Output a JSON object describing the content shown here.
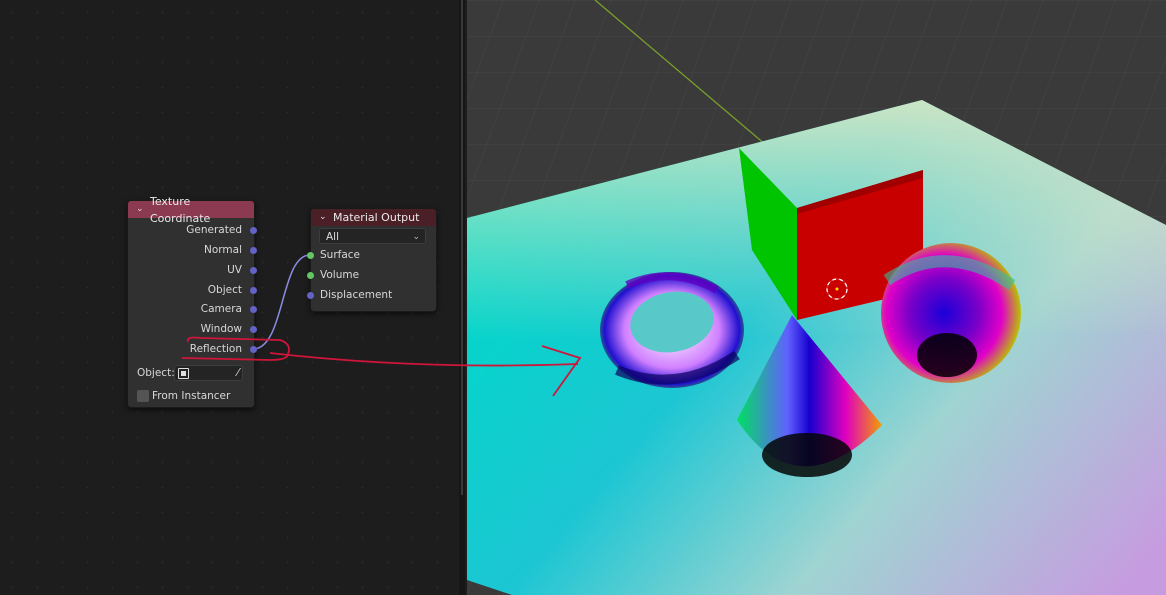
{
  "texture_coordinate_node": {
    "title": "Texture Coordinate",
    "outputs": [
      "Generated",
      "Normal",
      "UV",
      "Object",
      "Camera",
      "Window",
      "Reflection"
    ],
    "object_label": "Object:",
    "from_instancer_label": "From Instancer"
  },
  "material_output_node": {
    "title": "Material Output",
    "target": "All",
    "inputs": [
      "Surface",
      "Volume",
      "Displacement"
    ]
  },
  "icons": {
    "collapse": "chevron-down-icon",
    "object": "object-icon",
    "eyedropper": "eyedropper-icon",
    "cursor": "3d-cursor-icon"
  },
  "colors": {
    "tex_coord_header": "#8c3a52",
    "material_output_header": "#4a1f26",
    "vector_socket": "#6363c7",
    "shader_socket": "#63c763",
    "annotation": "#d0153a"
  }
}
